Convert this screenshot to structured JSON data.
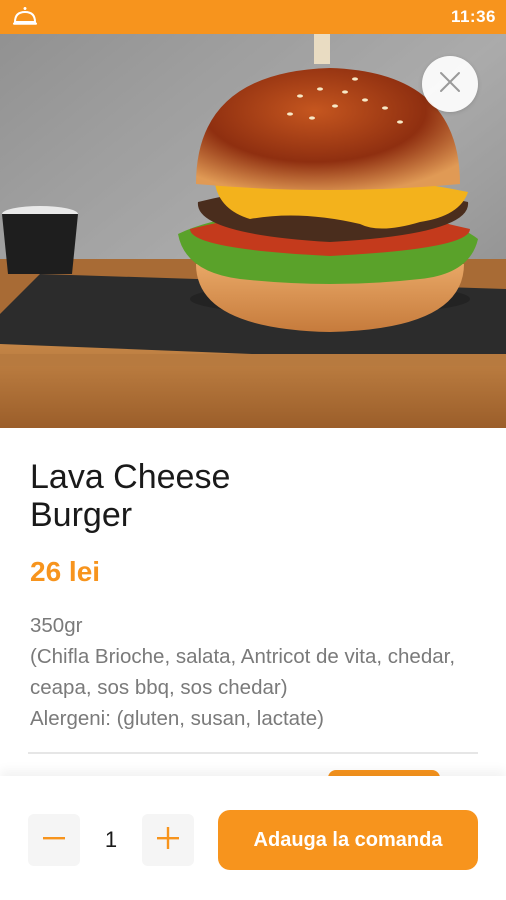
{
  "status_bar": {
    "time": "11:36",
    "app_icon": "bell-icon"
  },
  "product": {
    "title": "Lava Cheese Burger",
    "price": "26 lei",
    "weight": "350gr",
    "ingredients": "(Chifla Brioche, salata, Antricot de vita, chedar, ceapa, sos bbq, sos chedar)",
    "allergens": "Alergeni: (gluten, susan, lactate)"
  },
  "cart": {
    "quantity": "1",
    "add_label": "Adauga la comanda"
  },
  "colors": {
    "accent": "#f7941d",
    "text": "#1a1a1a",
    "muted": "#7a7a7a"
  },
  "icons": {
    "close": "close-icon",
    "minus": "minus-icon",
    "plus": "plus-icon"
  }
}
